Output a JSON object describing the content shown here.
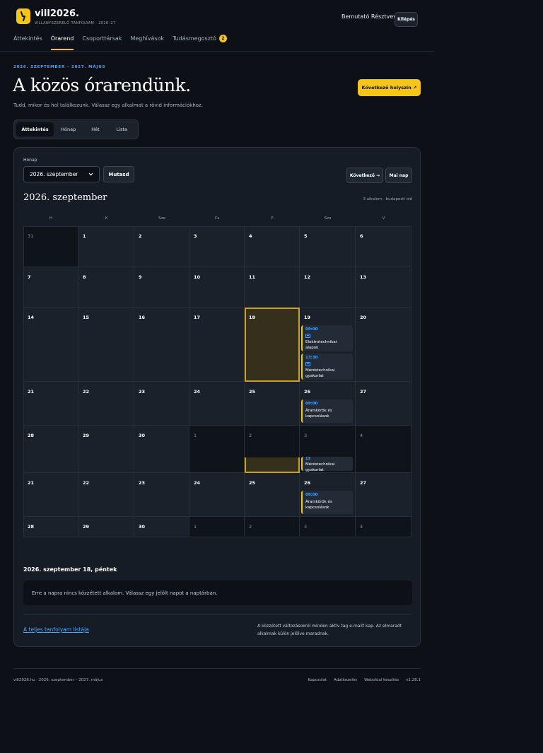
{
  "brand": {
    "name": "vill2026.",
    "subtitle": "VILLANYSZERELŐ TANFOLYAM · 2026–27"
  },
  "header": {
    "user": "Bemutató Résztvevő",
    "logout": "Kilépés"
  },
  "nav": [
    {
      "label": "Áttekintés",
      "active": false
    },
    {
      "label": "Órarend",
      "active": true
    },
    {
      "label": "Csoporttársak",
      "active": false
    },
    {
      "label": "Meghívások",
      "active": false
    },
    {
      "label": "Tudásmegosztó",
      "active": false,
      "badge": "2"
    }
  ],
  "hero": {
    "eyebrow": "2026. SZEPTEMBER – 2027. MÁJUS",
    "title": "A közös órarendünk.",
    "subtitle": "Tudd, mikor és hol találkozunk. Válassz egy alkalmat a rövid információkhoz.",
    "next_venue": "Következő helyszín ↗"
  },
  "views": [
    {
      "label": "Áttekintés",
      "active": true
    },
    {
      "label": "Hónap",
      "active": false
    },
    {
      "label": "Hét",
      "active": false
    },
    {
      "label": "Lista",
      "active": false
    }
  ],
  "controls": {
    "month_label": "Hónap",
    "month_value": "2026. szeptember",
    "show": "Mutasd",
    "next": "Következő →",
    "today": "Mai nap"
  },
  "calendar": {
    "title": "2026. szeptember",
    "meta": "3 alkalom · budapesti idő",
    "weekdays": [
      "H",
      "K",
      "Sze",
      "Cs",
      "P",
      "Szo",
      "V"
    ],
    "rows": [
      [
        {
          "d": "31",
          "muted": true
        },
        {
          "d": "1"
        },
        {
          "d": "2"
        },
        {
          "d": "3"
        },
        {
          "d": "4"
        },
        {
          "d": "5"
        },
        {
          "d": "6"
        }
      ],
      [
        {
          "d": "7"
        },
        {
          "d": "8"
        },
        {
          "d": "9"
        },
        {
          "d": "10"
        },
        {
          "d": "11"
        },
        {
          "d": "12"
        },
        {
          "d": "13"
        }
      ],
      [
        {
          "d": "14"
        },
        {
          "d": "15"
        },
        {
          "d": "16"
        },
        {
          "d": "17"
        },
        {
          "d": "18",
          "today": true
        },
        {
          "d": "19"
        },
        {
          "d": "20"
        }
      ],
      [
        {
          "d": "21"
        },
        {
          "d": "22"
        },
        {
          "d": "23"
        },
        {
          "d": "24"
        },
        {
          "d": "25"
        },
        {
          "d": "26"
        },
        {
          "d": "27"
        }
      ],
      [
        {
          "d": "28"
        },
        {
          "d": "29"
        },
        {
          "d": "30"
        },
        {
          "d": "1",
          "muted": true
        },
        {
          "d": "2",
          "muted": true
        },
        {
          "d": "3",
          "muted": true
        },
        {
          "d": "4",
          "muted": true
        }
      ],
      [
        {
          "d": "21"
        },
        {
          "d": "22"
        },
        {
          "d": "23"
        },
        {
          "d": "24"
        },
        {
          "d": "25"
        },
        {
          "d": "26"
        },
        {
          "d": "27"
        }
      ],
      [
        {
          "d": "28"
        },
        {
          "d": "29"
        },
        {
          "d": "30"
        },
        {
          "d": "1",
          "muted": true
        },
        {
          "d": "2",
          "muted": true
        },
        {
          "d": "3",
          "muted": true
        },
        {
          "d": "4",
          "muted": true
        }
      ]
    ],
    "events": [
      {
        "row": 2,
        "col": 5,
        "slot": 0,
        "time": "09:00",
        "name": "Elektrotechnikai alapok",
        "icon": "calendar-icon"
      },
      {
        "row": 2,
        "col": 5,
        "slot": 1,
        "time": "13:30",
        "name": "Méréstechnikai gyakorlat",
        "icon": "calendar-icon"
      },
      {
        "row": 3,
        "col": 5,
        "slot": 0,
        "time": "09:00",
        "name": "Áramkörök és kapcsolások"
      },
      {
        "row": 5,
        "col": 5,
        "slot": 0,
        "time": "09:00",
        "name": "Áramkörök és kapcsolások"
      }
    ],
    "ghost_event": {
      "time": "13",
      "name": "Méréstechnikai gyakorlat"
    }
  },
  "detail": {
    "title": "2026. szeptember 18, péntek",
    "empty": "Erre a napra nincs közzétett alkalom. Válassz egy jelölt napot a naptárban.",
    "full_list": "A teljes tanfolyam listája",
    "notice": "A közzétett változásokról minden aktív tag e-mailt kap. Az elmaradt alkalmak külön jelölve maradnak."
  },
  "footer": {
    "left": "vill2026.hu · 2026. szeptember – 2027. május",
    "links": [
      "Kapcsolat",
      "Adatkezelés",
      "Weboldal készítés",
      "v1.28.1"
    ]
  },
  "colors": {
    "accent": "#f5c518",
    "link": "#4aa3ff",
    "background": "#0d1117",
    "panel": "#161c25"
  }
}
